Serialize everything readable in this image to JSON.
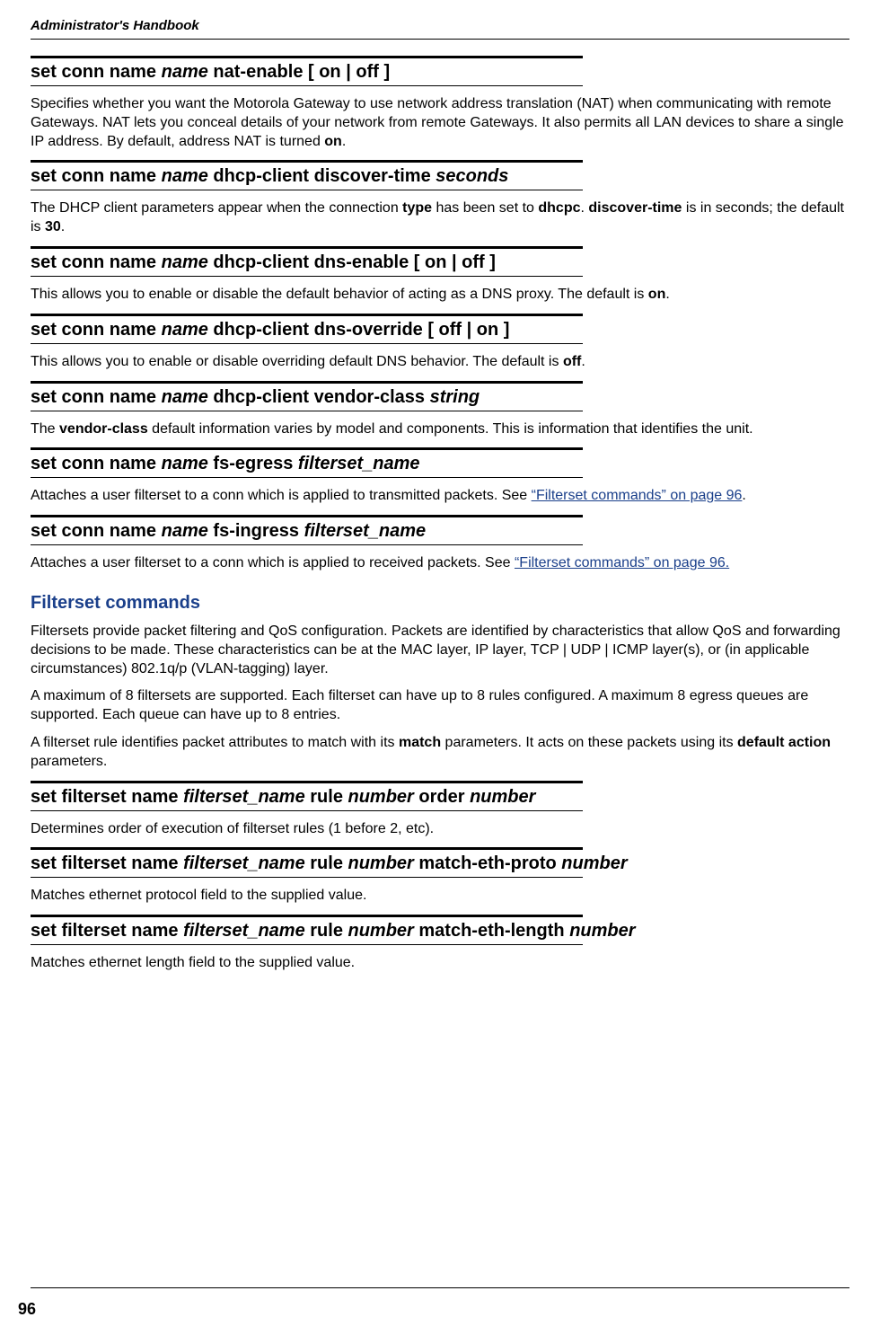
{
  "header": {
    "running_title": "Administrator's Handbook"
  },
  "sections": [
    {
      "heading_parts": [
        "set conn name ",
        "name",
        " nat-enable [ on | off ]"
      ],
      "body_html": "Specifies whether you want the Motorola Gateway to use network address translation (NAT) when communicating with remote Gateways. NAT lets you conceal details of your network from remote Gateways. It also permits all LAN devices to share a single IP address. By default, address NAT is turned <b>on</b>."
    },
    {
      "heading_parts": [
        "set conn name ",
        "name",
        " dhcp-client discover-time ",
        "seconds"
      ],
      "body_html": "The DHCP client parameters appear when the connection <b>type</b> has been set to <b>dhcpc</b>. <b>discover-time</b> is in seconds; the default is <b>30</b>."
    },
    {
      "heading_parts": [
        "set conn name ",
        "name",
        " dhcp-client dns-enable [ on | off ]"
      ],
      "body_html": "This allows you to enable or disable the default behavior of acting as a DNS proxy. The default is <b>on</b>."
    },
    {
      "heading_parts": [
        "set conn name ",
        "name",
        " dhcp-client dns-override [ off | on ]"
      ],
      "body_html": "This allows you to enable or disable overriding default DNS behavior. The default is <b>off</b>."
    },
    {
      "heading_parts": [
        "set conn name ",
        "name",
        " dhcp-client vendor-class ",
        "string"
      ],
      "body_html": "The <b>vendor-class</b> default information varies by model and components. This is information that identifies the unit."
    },
    {
      "heading_parts": [
        "set conn name ",
        "name",
        " fs-egress ",
        "filterset_name"
      ],
      "body_html": "Attaches a user filterset to a conn which is applied to transmitted packets. See <a class=\"ref-link\" href=\"#\">“Filterset commands” on page 96</a>."
    },
    {
      "heading_parts": [
        "set conn  name ",
        "name",
        " fs-ingress ",
        "filterset_name"
      ],
      "body_html": "Attaches a user filterset to a conn which is applied to received packets. See <a class=\"ref-link\" href=\"#\">“Filterset commands” on page 96.</a>"
    }
  ],
  "filterset_section": {
    "title": "Filterset commands",
    "paragraphs": [
      "Filtersets provide packet filtering and QoS configuration. Packets are identified by characteristics that allow QoS and forwarding decisions to be made. These characteristics can be at the MAC layer, IP layer, TCP | UDP | ICMP layer(s), or (in applicable circumstances) 802.1q/p (VLAN-tagging) layer.",
      "A maximum of 8 filtersets are supported. Each filterset can have up to 8 rules configured.  A maximum 8 egress queues are supported. Each queue can have up to 8 entries.",
      "A filterset rule identifies packet attributes to match with its <b>match</b> parameters. It acts on these packets using its <b>default action</b> parameters."
    ],
    "commands": [
      {
        "heading_parts": [
          "set filterset name ",
          "filterset_name",
          " rule ",
          "number",
          " order ",
          "number"
        ],
        "body_html": "Determines order of execution of filterset rules (1 before 2, etc)."
      },
      {
        "heading_parts": [
          "set filterset name ",
          "filterset_name",
          " rule ",
          "number",
          " match-eth-proto  ",
          "number"
        ],
        "body_html": "Matches ethernet protocol field to the supplied value."
      },
      {
        "heading_parts": [
          "set filterset name ",
          "filterset_name",
          " rule ",
          "number",
          " match-eth-length  ",
          "number"
        ],
        "body_html": "Matches ethernet length field to the supplied value."
      }
    ]
  },
  "footer": {
    "page_number": "96"
  }
}
